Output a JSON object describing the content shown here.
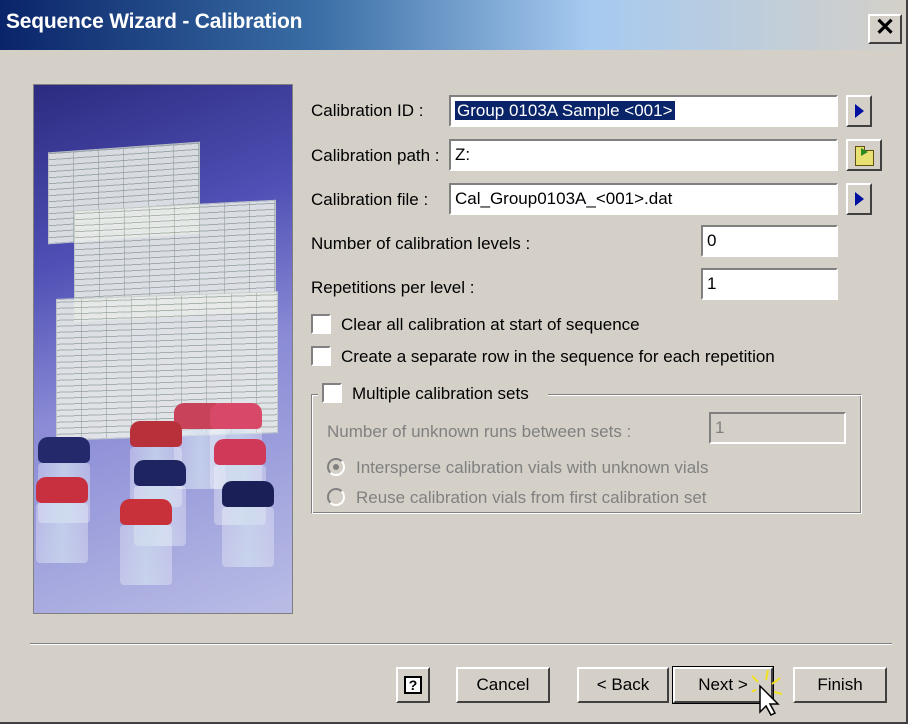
{
  "window": {
    "title": "Sequence Wizard - Calibration",
    "close_label": "✕"
  },
  "form": {
    "calibration_id": {
      "label": "Calibration ID :",
      "value": "Group 0103A Sample <001>"
    },
    "calibration_path": {
      "label": "Calibration path :",
      "value": "Z:"
    },
    "calibration_file": {
      "label": "Calibration file :",
      "value": "Cal_Group0103A_<001>.dat"
    },
    "num_levels": {
      "label": "Number of calibration levels :",
      "value": "0"
    },
    "repetitions": {
      "label": "Repetitions per level :",
      "value": "1"
    },
    "clear_all_label": "Clear all calibration at start of sequence",
    "separate_row_label": "Create a separate row in the sequence for each repetition"
  },
  "multiple_sets": {
    "label": "Multiple calibration sets",
    "unknown_runs_label": "Number of unknown runs between sets :",
    "unknown_runs_value": "1",
    "intersperse_label": "Intersperse calibration vials with unknown vials",
    "reuse_label": "Reuse calibration vials from first calibration set"
  },
  "buttons": {
    "help": "?",
    "cancel": "Cancel",
    "back": "< Back",
    "next": "Next >",
    "finish": "Finish"
  },
  "icons": {
    "side_arrow": "right-triangle-icon",
    "browse": "open-folder-icon",
    "help": "help-icon",
    "cursor": "mouse-pointer-icon"
  },
  "colors": {
    "title_start": "#0a246a",
    "dialog_bg": "#d4d0c8",
    "selection": "#0a246a"
  }
}
